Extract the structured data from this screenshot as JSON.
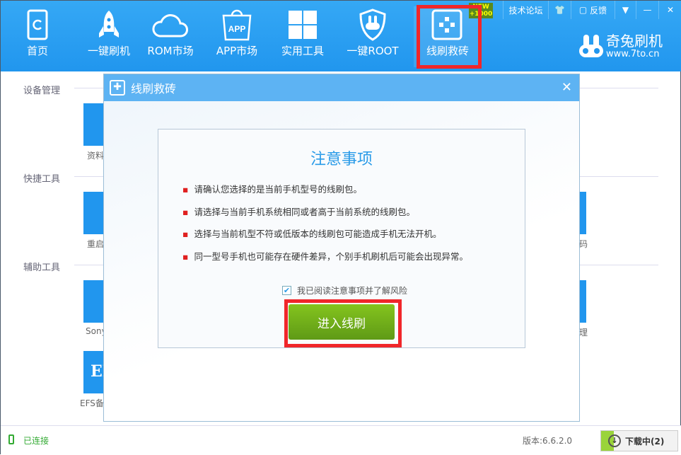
{
  "nav": [
    {
      "label": "首页",
      "icon": "phone-refresh-icon"
    },
    {
      "label": "一键刷机",
      "icon": "rocket-icon"
    },
    {
      "label": "ROM市场",
      "icon": "cloud-icon"
    },
    {
      "label": "APP市场",
      "icon": "shopping-bag-icon",
      "badge": "APP"
    },
    {
      "label": "实用工具",
      "icon": "grid-icon"
    },
    {
      "label": "一键ROOT",
      "icon": "shield-rabbit-icon"
    },
    {
      "label": "线刷救砖",
      "icon": "plus-dots-icon",
      "active": true,
      "badge": "NEW",
      "badge2": "+1000"
    }
  ],
  "top": {
    "forum": "技术论坛",
    "feedback": "反馈"
  },
  "logo": {
    "name": "奇兔刷机",
    "url": "www.7to.cn"
  },
  "sections": [
    "设备管理",
    "快捷工具",
    "辅助工具"
  ],
  "tiles": [
    "资料",
    "重启",
    "Sony",
    "EFS备份还原",
    "码",
    "理"
  ],
  "dialog": {
    "title": "线刷救砖",
    "heading": "注意事项",
    "items": [
      "请确认您选择的是当前手机型号的线刷包。",
      "请选择与当前手机系统相同或者高于当前系统的线刷包。",
      "选择与当前机型不符或低版本的线刷包可能造成手机无法开机。",
      "同一型号手机也可能存在硬件差异，个别手机刷机后可能会出现异常。"
    ],
    "checkbox": "我已阅读注意事项并了解风险",
    "checked": true,
    "button": "进入线刷"
  },
  "status": {
    "connected": "已连接",
    "version": "版本:6.6.2.0",
    "download": "下载中(2)"
  },
  "colors": {
    "brand": "#2196ee",
    "highlight": "#f0262a",
    "button": "#6fae1a"
  }
}
